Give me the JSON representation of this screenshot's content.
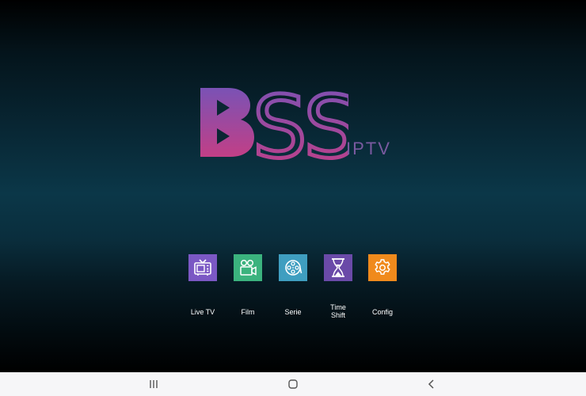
{
  "logo": {
    "main_letters": "SS",
    "subtitle": "IPTV",
    "colors": {
      "gradient_top": "#7a52b5",
      "gradient_bottom": "#c23f86"
    }
  },
  "menu": [
    {
      "label": "Live TV",
      "icon": "tv-icon",
      "color": "#7b58c4"
    },
    {
      "label": "Film",
      "icon": "video-camera-icon",
      "color": "#3bb37e"
    },
    {
      "label": "Serie",
      "icon": "film-reel-icon",
      "color": "#3f9ec0"
    },
    {
      "label": "Time\nShift",
      "icon": "hourglass-icon",
      "color": "#6a4aa8"
    },
    {
      "label": "Config",
      "icon": "gear-icon",
      "color": "#f08a1c"
    }
  ],
  "navbar": {
    "buttons": [
      "recent-apps-icon",
      "home-icon",
      "back-icon"
    ]
  }
}
